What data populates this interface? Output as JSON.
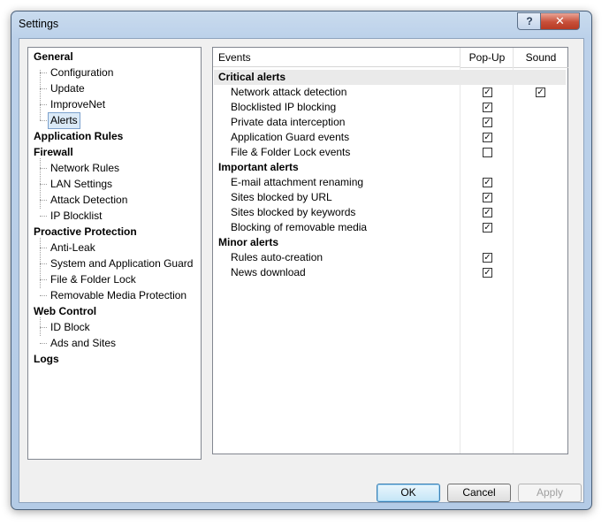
{
  "window": {
    "title": "Settings",
    "help_glyph": "?",
    "close_glyph": "✕"
  },
  "tree": {
    "general": {
      "label": "General",
      "children": [
        "Configuration",
        "Update",
        "ImproveNet",
        "Alerts"
      ]
    },
    "application_rules": {
      "label": "Application Rules"
    },
    "firewall": {
      "label": "Firewall",
      "children": [
        "Network Rules",
        "LAN Settings",
        "Attack Detection",
        "IP Blocklist"
      ]
    },
    "proactive": {
      "label": "Proactive Protection",
      "children": [
        "Anti-Leak",
        "System and Application Guard",
        "File & Folder Lock",
        "Removable Media Protection"
      ]
    },
    "web_control": {
      "label": "Web Control",
      "children": [
        "ID Block",
        "Ads and Sites"
      ]
    },
    "logs": {
      "label": "Logs"
    },
    "selected": "Alerts"
  },
  "alerts": {
    "headers": {
      "events": "Events",
      "popup": "Pop-Up",
      "sound": "Sound"
    },
    "groups": [
      {
        "title": "Critical alerts",
        "rows": [
          {
            "label": "Network attack detection",
            "popup": true,
            "sound": true
          },
          {
            "label": "Blocklisted IP blocking",
            "popup": true,
            "sound": false
          },
          {
            "label": "Private data interception",
            "popup": true,
            "sound": false
          },
          {
            "label": "Application Guard events",
            "popup": true,
            "sound": false
          },
          {
            "label": "File & Folder Lock events",
            "popup": false,
            "sound": false
          }
        ]
      },
      {
        "title": "Important alerts",
        "rows": [
          {
            "label": "E-mail attachment renaming",
            "popup": true,
            "sound": false
          },
          {
            "label": "Sites blocked by URL",
            "popup": true,
            "sound": false
          },
          {
            "label": "Sites blocked by keywords",
            "popup": true,
            "sound": false
          },
          {
            "label": "Blocking of removable media",
            "popup": true,
            "sound": false
          }
        ]
      },
      {
        "title": "Minor alerts",
        "rows": [
          {
            "label": "Rules auto-creation",
            "popup": true,
            "sound": false
          },
          {
            "label": "News download",
            "popup": true,
            "sound": false
          }
        ]
      }
    ],
    "check_glyph": "✓"
  },
  "buttons": {
    "ok": "OK",
    "cancel": "Cancel",
    "apply": "Apply"
  }
}
